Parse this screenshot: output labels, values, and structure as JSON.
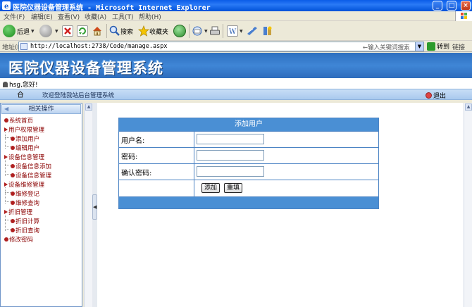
{
  "window": {
    "title": "医院仪器设备管理系统 - Microsoft Internet Explorer"
  },
  "menu": [
    "文件(F)",
    "编辑(E)",
    "查看(V)",
    "收藏(A)",
    "工具(T)",
    "帮助(H)"
  ],
  "toolbar": {
    "back": "后退",
    "search": "搜索",
    "favorites": "收藏夹"
  },
  "address": {
    "label": "地址(D)",
    "url": "http://localhost:2738/Code/manage.aspx",
    "search_hint": "←输入关键词搜索",
    "go": "转到",
    "links": "链接"
  },
  "page": {
    "system_title": "医院仪器设备管理系统",
    "user_greeting": "hsg,您好!",
    "welcome": "欢迎登陆我站后台管理系统",
    "logout": "退出"
  },
  "sidebar": {
    "header": "相关操作",
    "items": [
      {
        "label": "系统首页"
      },
      {
        "label": "用户权限管理"
      },
      {
        "label": "添加用户"
      },
      {
        "label": "编辑用户"
      },
      {
        "label": "设备信息管理"
      },
      {
        "label": "设备信息添加"
      },
      {
        "label": "设备信息管理"
      },
      {
        "label": "设备维修管理"
      },
      {
        "label": "维修登记"
      },
      {
        "label": "维修查询"
      },
      {
        "label": "折旧管理"
      },
      {
        "label": "折旧计算"
      },
      {
        "label": "折旧查询"
      },
      {
        "label": "修改密码"
      }
    ]
  },
  "form": {
    "title": "添加用户",
    "username_label": "用户名:",
    "password_label": "密码:",
    "confirm_label": "确认密码:",
    "username_value": "",
    "password_value": "",
    "confirm_value": "",
    "add_button": "添加",
    "reset_button": "重填"
  },
  "colors": {
    "title_bar": "#0a5ce8",
    "header_blue": "#3f86d6",
    "form_header": "#4a8fd4",
    "sidebar_text": "#8b0000"
  }
}
